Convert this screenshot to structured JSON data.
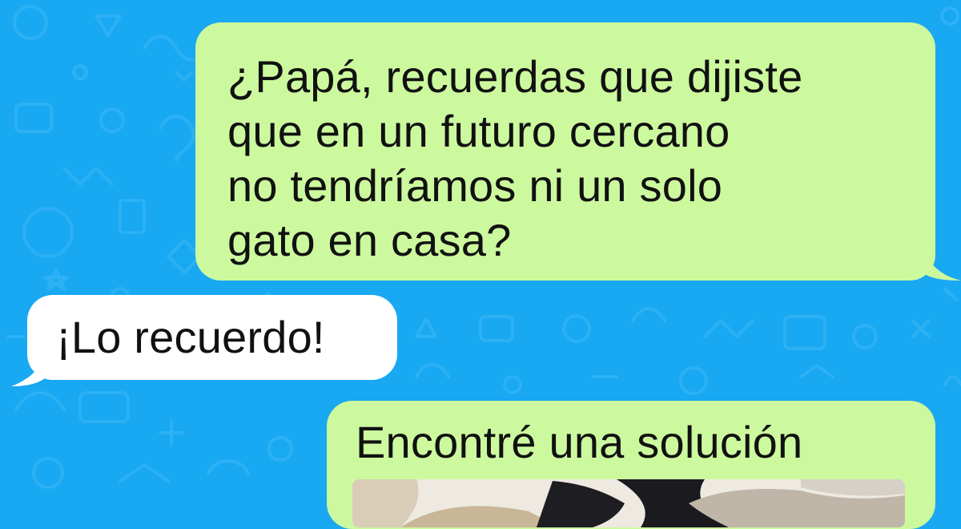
{
  "chat": {
    "background_color": "#19a8f2",
    "sent_bubble_color": "#ccf99e",
    "received_bubble_color": "#ffffff",
    "messages": [
      {
        "direction": "sent",
        "text": "¿Papá, recuerdas que dijiste\nque en un futuro cercano\nno tendríamos ni un solo\ngato en casa?"
      },
      {
        "direction": "received",
        "text": "¡Lo recuerdo!"
      },
      {
        "direction": "sent",
        "text": "Encontré una solución",
        "attachment": "cat-photo"
      }
    ]
  }
}
